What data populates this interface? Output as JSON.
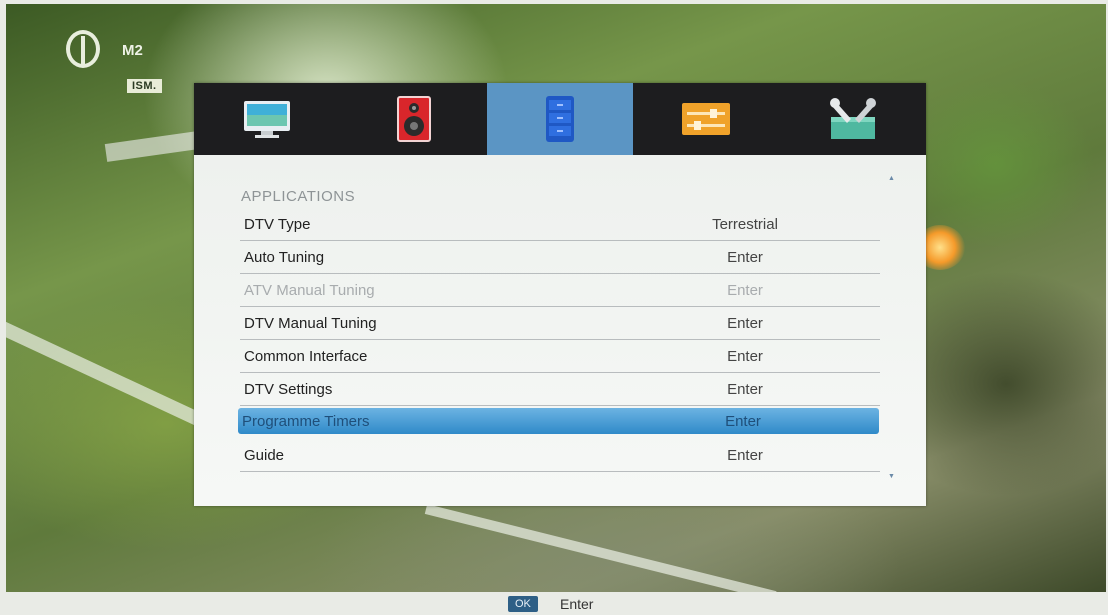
{
  "channel": {
    "name": "M2",
    "source": "ISM."
  },
  "tabs": [
    {
      "name": "picture",
      "icon": "monitor-icon",
      "active": false
    },
    {
      "name": "sound",
      "icon": "speaker-icon",
      "active": false
    },
    {
      "name": "channel",
      "icon": "applications-icon",
      "active": true
    },
    {
      "name": "settings",
      "icon": "sliders-icon",
      "active": false
    },
    {
      "name": "tools",
      "icon": "tools-icon",
      "active": false
    }
  ],
  "menu": {
    "section_title": "APPLICATIONS",
    "items": [
      {
        "label": "DTV Type",
        "value": "Terrestrial",
        "state": "normal"
      },
      {
        "label": "Auto Tuning",
        "value": "Enter",
        "state": "normal"
      },
      {
        "label": "ATV Manual Tuning",
        "value": "Enter",
        "state": "disabled"
      },
      {
        "label": "DTV Manual Tuning",
        "value": "Enter",
        "state": "normal"
      },
      {
        "label": "Common Interface",
        "value": "Enter",
        "state": "normal"
      },
      {
        "label": "DTV Settings",
        "value": "Enter",
        "state": "normal"
      },
      {
        "label": "Programme Timers",
        "value": "Enter",
        "state": "selected"
      },
      {
        "label": "Guide",
        "value": "Enter",
        "state": "normal"
      }
    ]
  },
  "footer": {
    "key": "OK",
    "hint": "Enter"
  },
  "colors": {
    "accent": "#5b95c4",
    "selected_row": "#2f8ac9",
    "tabbar": "#1d1d1f"
  }
}
